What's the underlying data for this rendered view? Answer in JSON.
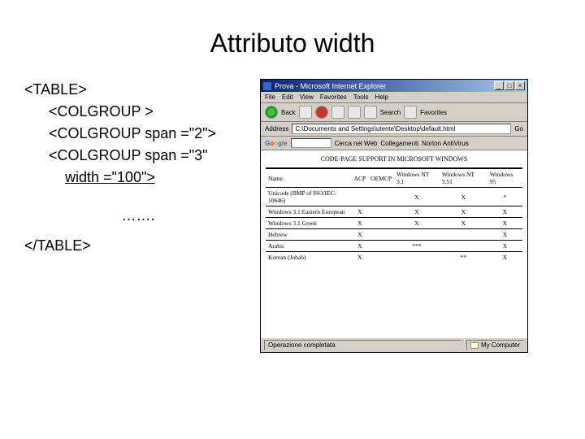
{
  "title": "Attributo width",
  "code": {
    "l1": "<TABLE>",
    "l2": "<COLGROUP >",
    "l3": "<COLGROUP span =\"2\">",
    "l4": "<COLGROUP span =\"3\"",
    "l5": "width =\"100\">",
    "dots": "…….",
    "l6": "</TABLE>"
  },
  "ie": {
    "title": "Prova - Microsoft Internet Explorer",
    "min": "_",
    "max": "□",
    "close": "×",
    "menu": {
      "m1": "File",
      "m2": "Edit",
      "m3": "View",
      "m4": "Favorites",
      "m5": "Tools",
      "m6": "Help"
    },
    "toolbar": {
      "back": "Back",
      "search": "Search",
      "fav": "Favorites"
    },
    "addr_label": "Address",
    "addr_value": "C:\\Documents and Settings\\utente\\Desktop\\default.html",
    "go": "Go",
    "google": {
      "label": "Google",
      "opt1": "Cerca nel Web",
      "opt2": "Collegamenti",
      "opt3": "Norton AntiVirus"
    },
    "page_title": "CODE-PAGE SUPPORT IN MICROSOFT WINDOWS",
    "headers": {
      "h1": "Name",
      "h2": "ACP",
      "h3": "OEMCP",
      "h4": "Windows NT 3.1",
      "h5": "Windows NT 3.51",
      "h6": "Windows 95"
    },
    "rows": [
      {
        "name": "Unicode (BMP of ISO/IEC-10646)",
        "acp": "",
        "oem": "",
        "c1": "X",
        "c2": "X",
        "c3": "*"
      },
      {
        "name": "Windows 3.1 Eastern European",
        "acp": "X",
        "oem": "",
        "c1": "X",
        "c2": "X",
        "c3": "X"
      },
      {
        "name": "Windows 3.1 Greek",
        "acp": "X",
        "oem": "",
        "c1": "X",
        "c2": "X",
        "c3": "X"
      },
      {
        "name": "Hebrew",
        "acp": "X",
        "oem": "",
        "c1": "",
        "c2": "",
        "c3": "X"
      },
      {
        "name": "Arabic",
        "acp": "X",
        "oem": "",
        "c1": "***",
        "c2": "",
        "c3": "X"
      },
      {
        "name": "Korean (Johab)",
        "acp": "X",
        "oem": "",
        "c1": "",
        "c2": "**",
        "c3": "X"
      }
    ],
    "status_left": "Operazione completata",
    "status_right": "My Computer"
  }
}
